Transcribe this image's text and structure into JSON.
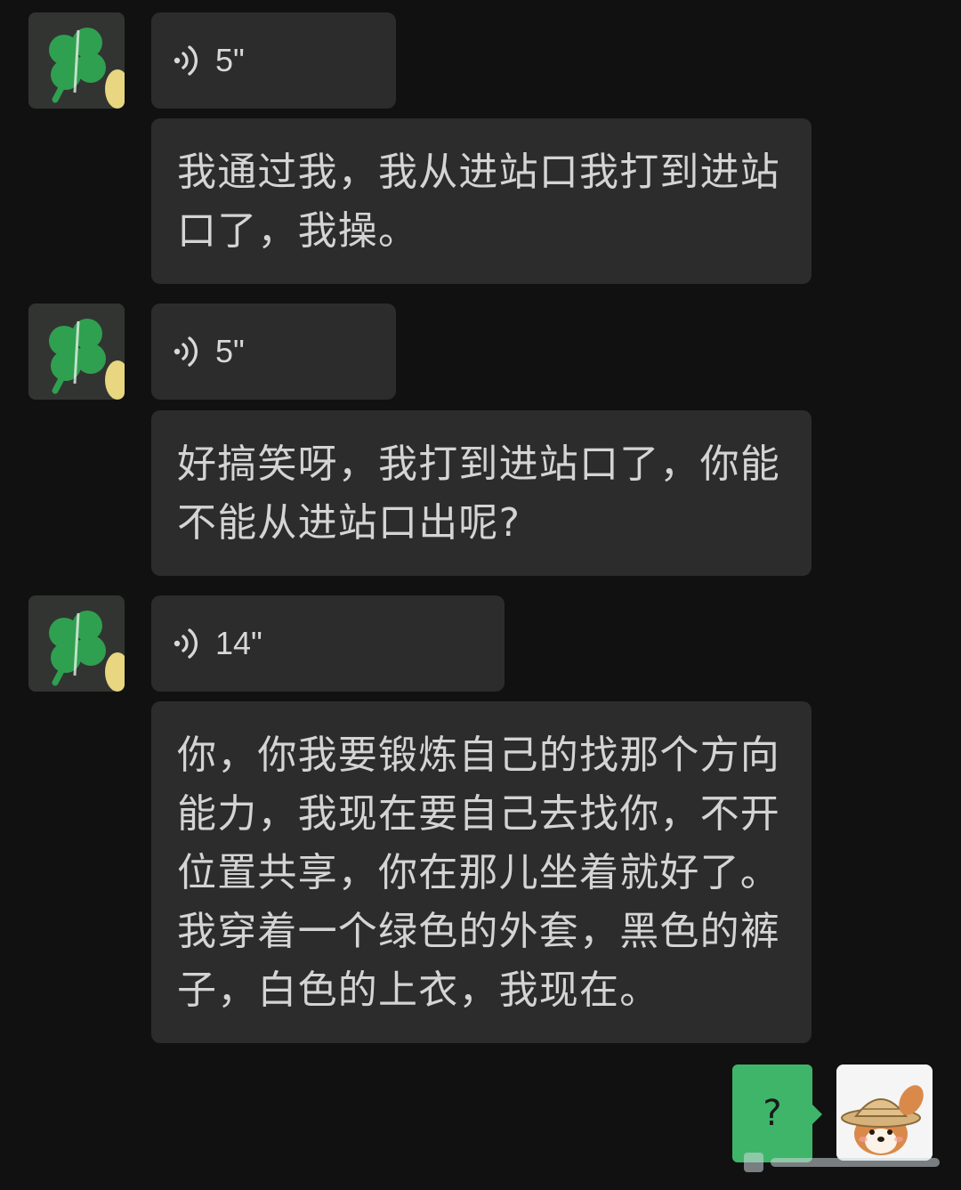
{
  "conversation": {
    "messages": [
      {
        "type": "voice",
        "sender": "contact",
        "duration": "5\""
      },
      {
        "type": "transcript",
        "sender": "contact",
        "text": "我通过我，我从进站口我打到进站口了，我操。"
      },
      {
        "type": "voice",
        "sender": "contact",
        "duration": "5\""
      },
      {
        "type": "transcript",
        "sender": "contact",
        "text": "好搞笑呀，我打到进站口了，你能不能从进站口出呢?"
      },
      {
        "type": "voice",
        "sender": "contact",
        "duration": "14\""
      },
      {
        "type": "transcript",
        "sender": "contact",
        "text": "你，你我要锻炼自己的找那个方向能力，我现在要自己去找你，不开位置共享，你在那儿坐着就好了。我穿着一个绿色的外套，黑色的裤子，白色的上衣，我现在。"
      },
      {
        "type": "text",
        "sender": "me",
        "text": "?"
      }
    ]
  },
  "icons": {
    "contact_avatar": "four-leaf-clover-avatar",
    "voice": "voice-wave-icon",
    "my_avatar": "cartoon-dog-straw-hat-avatar"
  },
  "colors": {
    "background": "#111111",
    "incoming_bubble": "#2c2c2c",
    "outgoing_bubble": "#3fb56a",
    "text": "#d4d4d4"
  }
}
